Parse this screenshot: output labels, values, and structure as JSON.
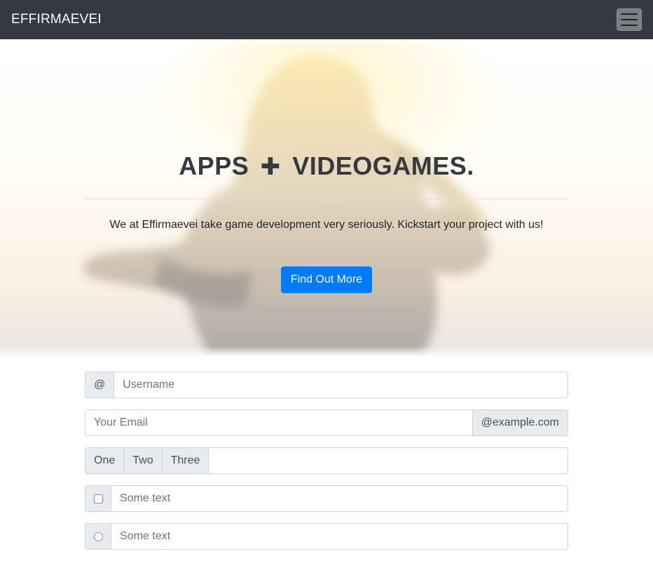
{
  "navbar": {
    "brand": "EFFIRMAEVEI",
    "menu_icon": "hamburger-icon"
  },
  "hero": {
    "title_left": "APPS",
    "title_plus": "✚",
    "title_right": "VIDEOGAMES.",
    "text": "We at Effirmaevei take game development very seriously. Kickstart your project with us!",
    "button_label": "Find Out More"
  },
  "form": {
    "username": {
      "prefix": "@",
      "placeholder": "Username"
    },
    "email": {
      "placeholder": "Your Email",
      "suffix": "@example.com"
    },
    "multi": {
      "addons": [
        "One",
        "Two",
        "Three"
      ],
      "value": ""
    },
    "checkbox_row": {
      "placeholder": "Some text",
      "checked": false
    },
    "radio_row": {
      "placeholder": "Some text",
      "selected": false
    }
  },
  "colors": {
    "navbar": "#343a40",
    "primary": "#007bff",
    "addon_bg": "#e9ecef",
    "border": "#ced4da"
  }
}
